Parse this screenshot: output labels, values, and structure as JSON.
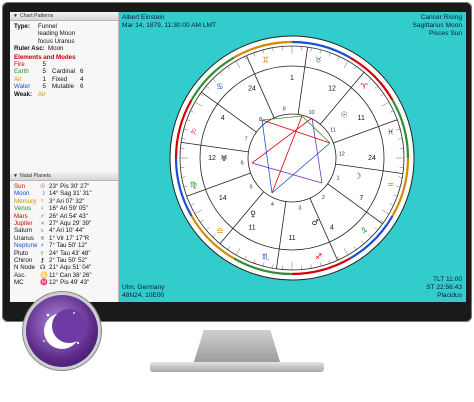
{
  "chart_patterns": {
    "header": "Chart Patterns",
    "type_label": "Type:",
    "type_value": "Funnel",
    "type_sub1": "leading Moon",
    "type_sub2": "focus Uranus",
    "ruler_label": "Ruler Asc:",
    "ruler_value": "Moon",
    "elements_heading": "Elements and Modes",
    "elements": [
      {
        "element": "Fire",
        "count": "5",
        "mode": "",
        "mode_count": "",
        "color": "#d40000"
      },
      {
        "element": "Earth",
        "count": "5",
        "mode": "Cardinal",
        "mode_count": "6",
        "color": "#2f8f2f"
      },
      {
        "element": "Air",
        "count": "1",
        "mode": "Fixed",
        "mode_count": "4",
        "color": "#d48a00"
      },
      {
        "element": "Water",
        "count": "5",
        "mode": "Mutable",
        "mode_count": "6",
        "color": "#1a4fd4"
      }
    ],
    "weak_label": "Weak:",
    "weak_value": "Air"
  },
  "natal_planets": {
    "header": "Natal Planets",
    "rows": [
      {
        "name": "Sun",
        "glyph": "☉",
        "pos": "23° Pis 30' 27\"",
        "color": "#d40000"
      },
      {
        "name": "Moon",
        "glyph": "☽",
        "pos": "14° Sag 31' 31\"",
        "color": "#1a4fd4"
      },
      {
        "name": "Mercury",
        "glyph": "☿",
        "pos": "3° Ari 07' 32\"",
        "color": "#d48a00"
      },
      {
        "name": "Venus",
        "glyph": "♀",
        "pos": "16° Ari 59' 05\"",
        "color": "#2f8f2f"
      },
      {
        "name": "Mars",
        "glyph": "♂",
        "pos": "26° Ari 54' 43\"",
        "color": "#d40000"
      },
      {
        "name": "Jupiter",
        "glyph": "♃",
        "pos": "27° Aqu 29' 39\"",
        "color": "#d40000"
      },
      {
        "name": "Saturn",
        "glyph": "♄",
        "pos": "4° Ari 10' 44\"",
        "color": "#111111"
      },
      {
        "name": "Uranus",
        "glyph": "♅",
        "pos": "1° Vir 17' 17\"R",
        "color": "#111111"
      },
      {
        "name": "Neptune",
        "glyph": "♆",
        "pos": "7° Tau 50' 12\"",
        "color": "#1a4fd4"
      },
      {
        "name": "Pluto",
        "glyph": "♇",
        "pos": "24° Tau 43' 48\"",
        "color": "#111111"
      },
      {
        "name": "Chiron",
        "glyph": "⚷",
        "pos": "2° Tau 50' 52\"",
        "color": "#111111"
      },
      {
        "name": "N Node",
        "glyph": "☊",
        "pos": "21° Aqu 51' 04\"",
        "color": "#111111"
      },
      {
        "name": "Asc.",
        "glyph": "♋",
        "pos": "11° Can 38' 26\"",
        "color": "#111111"
      },
      {
        "name": "MC",
        "glyph": "♓",
        "pos": "12° Pis 49' 43\"",
        "color": "#111111"
      }
    ]
  },
  "chart_header": {
    "name": "Albert Einstein",
    "datetime": "Mar 14, 1879, 11:30:00 AM LMT",
    "rising": "Cancer Rising",
    "moon": "Sagittarius Moon",
    "sun": "Pisces Sun"
  },
  "chart_footer": {
    "place": "Ulm, Germany",
    "coords": "48N24, 10E00",
    "tlt": "TLT 11:00",
    "st": "ST 22:56:43",
    "house_system": "Placidus"
  },
  "house_numbers": [
    "1",
    "2",
    "3",
    "4",
    "5",
    "6",
    "7",
    "8",
    "9",
    "10",
    "11",
    "12"
  ],
  "wheel_degrees": [
    {
      "text": "12",
      "color": "#111"
    },
    {
      "text": "11",
      "color": "#111"
    },
    {
      "text": "24",
      "color": "#111"
    },
    {
      "text": "7",
      "color": "#111"
    },
    {
      "text": "4",
      "color": "#111"
    },
    {
      "text": "11",
      "color": "#111"
    },
    {
      "text": "11",
      "color": "#111"
    },
    {
      "text": "14",
      "color": "#111"
    },
    {
      "text": "12",
      "color": "#111"
    },
    {
      "text": "4",
      "color": "#111"
    },
    {
      "text": "24",
      "color": "#111"
    },
    {
      "text": "1",
      "color": "#111"
    }
  ],
  "wheel_glyphs": [
    "♉",
    "♈",
    "♓",
    "♒",
    "♑",
    "♐",
    "♏",
    "♎",
    "♍",
    "♌",
    "♋",
    "♊",
    "☉",
    "☽",
    "♂",
    "♀",
    "♅"
  ],
  "colors": {
    "chart_bg": "#33cccc",
    "fire": "#d40000",
    "earth": "#2f8f2f",
    "air": "#d48a00",
    "water": "#1a4fd4",
    "app_icon": "#5b2a8a"
  }
}
